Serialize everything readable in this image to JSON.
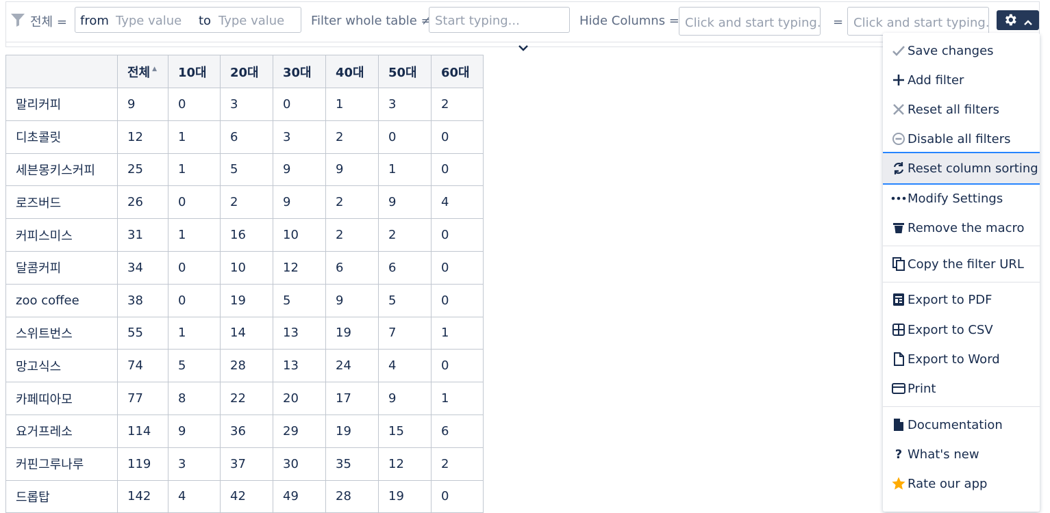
{
  "filter": {
    "column_label": "전체 =",
    "from_label": "from",
    "from_placeholder": "Type value",
    "to_label": "to",
    "to_placeholder": "Type value",
    "whole_table_label": "Filter whole table ≠",
    "whole_table_placeholder": "Start typing...",
    "hide_columns_label": "Hide Columns =",
    "hide_columns_placeholder": "Click and start typing...",
    "equals_label": "=",
    "second_placeholder": "Click and start typing..."
  },
  "table": {
    "headers": [
      "",
      "전체",
      "10대",
      "20대",
      "30대",
      "40대",
      "50대",
      "60대"
    ],
    "rows": [
      [
        "말리커피",
        "9",
        "0",
        "3",
        "0",
        "1",
        "3",
        "2"
      ],
      [
        "디초콜릿",
        "12",
        "1",
        "6",
        "3",
        "2",
        "0",
        "0"
      ],
      [
        "세븐몽키스커피",
        "25",
        "1",
        "5",
        "9",
        "9",
        "1",
        "0"
      ],
      [
        "로즈버드",
        "26",
        "0",
        "2",
        "9",
        "2",
        "9",
        "4"
      ],
      [
        "커피스미스",
        "31",
        "1",
        "16",
        "10",
        "2",
        "2",
        "0"
      ],
      [
        "달콤커피",
        "34",
        "0",
        "10",
        "12",
        "6",
        "6",
        "0"
      ],
      [
        "zoo coffee",
        "38",
        "0",
        "19",
        "5",
        "9",
        "5",
        "0"
      ],
      [
        "스위트번스",
        "55",
        "1",
        "14",
        "13",
        "19",
        "7",
        "1"
      ],
      [
        "망고식스",
        "74",
        "5",
        "28",
        "13",
        "24",
        "4",
        "0"
      ],
      [
        "카페띠아모",
        "77",
        "8",
        "22",
        "20",
        "17",
        "9",
        "1"
      ],
      [
        "요거프레소",
        "114",
        "9",
        "36",
        "29",
        "19",
        "15",
        "6"
      ],
      [
        "커핀그루나루",
        "119",
        "3",
        "37",
        "30",
        "35",
        "12",
        "2"
      ],
      [
        "드롭탑",
        "142",
        "4",
        "42",
        "49",
        "28",
        "19",
        "0"
      ]
    ]
  },
  "menu": {
    "items": [
      {
        "label": "Save changes",
        "icon": "check-icon",
        "disabled": true
      },
      {
        "label": "Add filter",
        "icon": "plus-icon",
        "disabled": false
      },
      {
        "label": "Reset all filters",
        "icon": "x-icon",
        "disabled": true
      },
      {
        "label": "Disable all filters",
        "icon": "minus-circle-icon",
        "disabled": true
      },
      {
        "label": "Reset column sorting",
        "icon": "refresh-icon",
        "disabled": false,
        "active": true
      },
      {
        "label": "Modify Settings",
        "icon": "more-icon",
        "disabled": false
      },
      {
        "label": "Remove the macro",
        "icon": "trash-icon",
        "disabled": false
      },
      {
        "label": "Copy the filter URL",
        "icon": "copy-icon",
        "disabled": false
      },
      {
        "label": "Export to PDF",
        "icon": "pdf-icon",
        "disabled": false
      },
      {
        "label": "Export to CSV",
        "icon": "grid-icon",
        "disabled": false
      },
      {
        "label": "Export to Word",
        "icon": "document-outline-icon",
        "disabled": false
      },
      {
        "label": "Print",
        "icon": "print-icon",
        "disabled": false
      },
      {
        "label": "Documentation",
        "icon": "file-icon",
        "disabled": false
      },
      {
        "label": "What's new",
        "icon": "question-icon",
        "disabled": false
      },
      {
        "label": "Rate our app",
        "icon": "star-icon",
        "disabled": false
      }
    ]
  },
  "colors": {
    "accent": "#2684ff",
    "dark_button": "#253858",
    "star": "#ffab00",
    "text": "#172b4d",
    "muted": "#97a0af"
  }
}
